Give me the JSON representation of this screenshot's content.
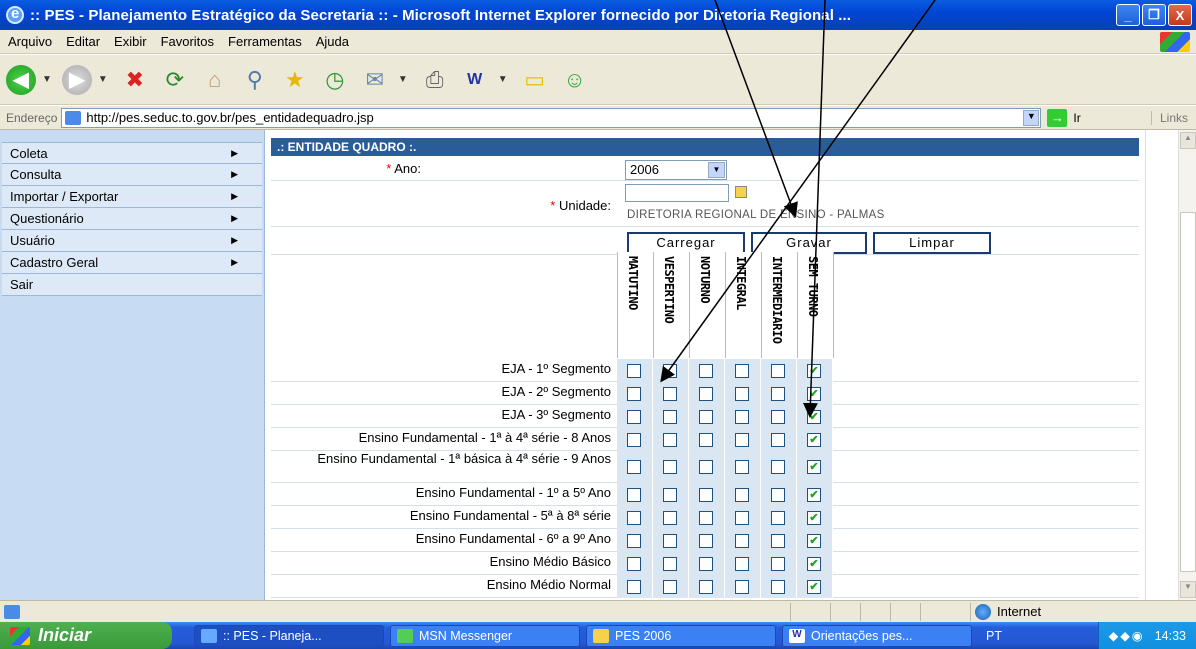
{
  "window": {
    "title": ":: PES - Planejamento Estratégico da Secretaria :: - Microsoft Internet Explorer fornecido por Diretoria Regional ...",
    "minimize": "_",
    "maximize": "❐",
    "close": "X"
  },
  "menubar": [
    "Arquivo",
    "Editar",
    "Exibir",
    "Favoritos",
    "Ferramentas",
    "Ajuda"
  ],
  "address": {
    "label": "Endereço",
    "url": "http://pes.seduc.to.gov.br/pes_entidadequadro.jsp",
    "go_label": "Ir",
    "links_label": "Links"
  },
  "sidebar": {
    "items": [
      {
        "label": "Coleta",
        "arrow": "▶"
      },
      {
        "label": "Consulta",
        "arrow": "▶"
      },
      {
        "label": "Importar / Exportar",
        "arrow": "▶"
      },
      {
        "label": "Questionário",
        "arrow": "▶"
      },
      {
        "label": "Usuário",
        "arrow": "▶"
      },
      {
        "label": "Cadastro Geral",
        "arrow": "▶"
      },
      {
        "label": "Sair",
        "arrow": ""
      }
    ]
  },
  "form": {
    "section_title": ".: ENTIDADE QUADRO :.",
    "required_mark": "*",
    "ano_label": "Ano:",
    "ano_value": "2006",
    "unidade_label": "Unidade:",
    "unidade_value": "",
    "unidade_name": "DIRETORIA REGIONAL DE ENSINO - PALMAS",
    "buttons": {
      "carregar": "Carregar",
      "gravar": "Gravar",
      "limpar": "Limpar"
    },
    "columns": [
      "MATUTINO",
      "VESPERTINO",
      "NOTURNO",
      "INTEGRAL",
      "INTERMEDIARIO",
      "SEM TURNO"
    ],
    "rows": [
      {
        "label": "EJA - 1º Segmento",
        "checked": [
          false,
          false,
          false,
          false,
          false,
          true
        ]
      },
      {
        "label": "EJA - 2º Segmento",
        "checked": [
          false,
          false,
          false,
          false,
          false,
          true
        ]
      },
      {
        "label": "EJA - 3º Segmento",
        "checked": [
          false,
          false,
          false,
          false,
          false,
          true
        ]
      },
      {
        "label": "Ensino Fundamental - 1ª à 4ª série - 8 Anos",
        "checked": [
          false,
          false,
          false,
          false,
          false,
          true
        ]
      },
      {
        "label": "Ensino Fundamental - 1ª básica à 4ª série - 9 Anos",
        "checked": [
          false,
          false,
          false,
          false,
          false,
          true
        ]
      },
      {
        "label": "Ensino Fundamental - 1º a 5º Ano",
        "checked": [
          false,
          false,
          false,
          false,
          false,
          true
        ]
      },
      {
        "label": "Ensino Fundamental - 5ª à 8ª série",
        "checked": [
          false,
          false,
          false,
          false,
          false,
          true
        ]
      },
      {
        "label": "Ensino Fundamental - 6º a 9º Ano",
        "checked": [
          false,
          false,
          false,
          false,
          false,
          true
        ]
      },
      {
        "label": "Ensino Médio Básico",
        "checked": [
          false,
          false,
          false,
          false,
          false,
          true
        ]
      },
      {
        "label": "Ensino Médio Normal",
        "checked": [
          false,
          false,
          false,
          false,
          false,
          true
        ]
      }
    ]
  },
  "statusbar": {
    "zone": "Internet"
  },
  "taskbar": {
    "start": "Iniciar",
    "tasks": [
      ":: PES - Planeja...",
      "MSN Messenger",
      "PES 2006",
      "Orientações pes..."
    ],
    "language": "PT",
    "clock": "14:33"
  }
}
